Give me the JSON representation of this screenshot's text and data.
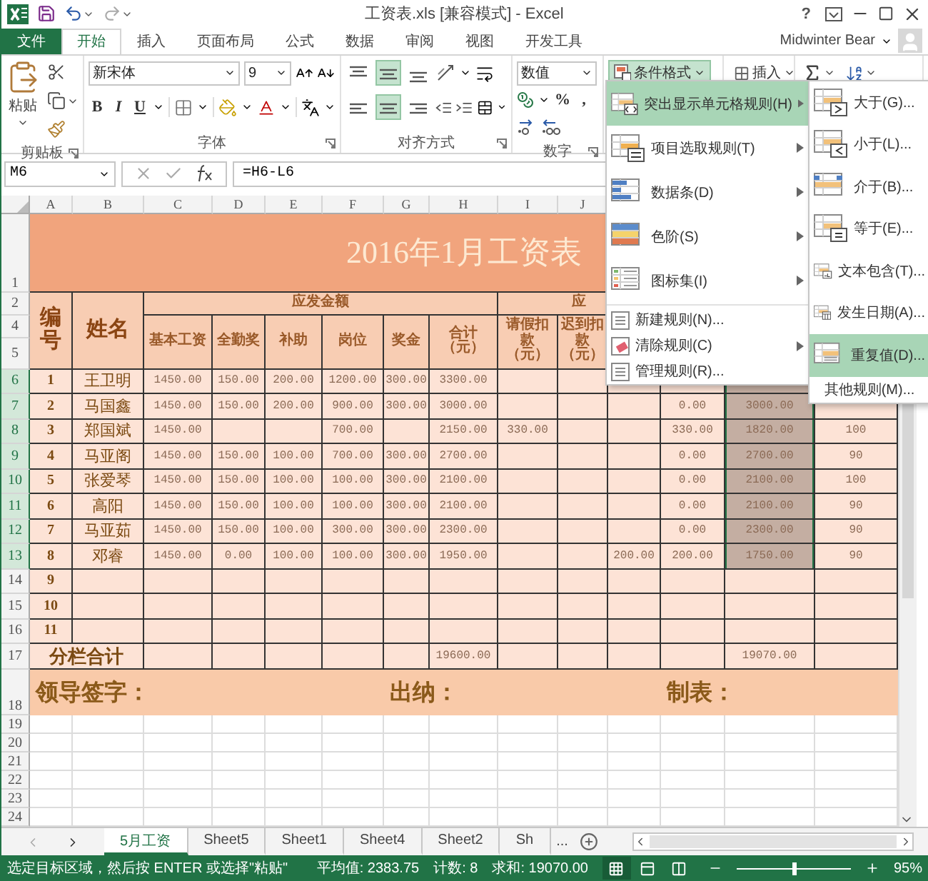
{
  "window": {
    "title": "工资表.xls  [兼容模式] - Excel",
    "help": "?"
  },
  "tabs": [
    {
      "label": "文件",
      "kind": "file",
      "selected": false
    },
    {
      "label": "开始",
      "kind": "tab",
      "selected": true
    },
    {
      "label": "插入",
      "kind": "tab",
      "selected": false
    },
    {
      "label": "页面布局",
      "kind": "tab",
      "selected": false
    },
    {
      "label": "公式",
      "kind": "tab",
      "selected": false
    },
    {
      "label": "数据",
      "kind": "tab",
      "selected": false
    },
    {
      "label": "审阅",
      "kind": "tab",
      "selected": false
    },
    {
      "label": "视图",
      "kind": "tab",
      "selected": false
    },
    {
      "label": "开发工具",
      "kind": "tab",
      "selected": false
    }
  ],
  "account": {
    "name": "Midwinter Bear"
  },
  "ribbon": {
    "clipboard": {
      "paste": "粘贴",
      "label": "剪贴板"
    },
    "font": {
      "family": "新宋体",
      "size": "9",
      "bold": "B",
      "italic": "I",
      "underline": "U",
      "label": "字体"
    },
    "alignment": {
      "vertical": [
        {
          "selected": false
        },
        {
          "selected": true
        },
        {
          "selected": false
        }
      ],
      "horizontal": [
        {
          "selected": false
        },
        {
          "selected": true
        },
        {
          "selected": false
        }
      ],
      "label": "对齐方式"
    },
    "number": {
      "format": "数值",
      "percent": "%",
      "comma": ",",
      "label": "数字"
    },
    "styles": {
      "conditional_formatting": "条件格式",
      "selected": true
    },
    "cells": {
      "insert": "插入"
    }
  },
  "formula_bar": {
    "name_box": "M6",
    "formula": "=H6-L6"
  },
  "sheet": {
    "columns": [
      "A",
      "B",
      "C",
      "D",
      "E",
      "F",
      "G",
      "H",
      "I",
      "J"
    ],
    "title": "2016年1月工资表",
    "header": {
      "number": "编号",
      "name": "姓名",
      "groups": [
        "应发金额",
        "应"
      ],
      "items": [
        "基本工资",
        "全勤奖",
        "补助",
        "岗位",
        "奖金",
        "合计（元）",
        "请假扣款（元）",
        "迟到扣款（元）"
      ]
    },
    "rows": [
      {
        "header": "1",
        "kind": "title",
        "selected": false
      },
      {
        "header": "2",
        "kind": "header",
        "selected": false
      },
      {
        "header": "4",
        "kind": "header",
        "selected": false
      },
      {
        "header": "5",
        "kind": "header",
        "selected": false
      },
      {
        "header": "6",
        "kind": "data",
        "selected": true,
        "cells": {
          "A": "1",
          "B": "王卫明",
          "C": "1450.00",
          "D": "150.00",
          "E": "200.00",
          "F": "1200.00",
          "G": "300.00",
          "H": "3300.00"
        }
      },
      {
        "header": "7",
        "kind": "data",
        "selected": true,
        "cells": {
          "A": "2",
          "B": "马国鑫",
          "C": "1450.00",
          "D": "150.00",
          "E": "200.00",
          "F": "900.00",
          "G": "300.00",
          "H": "3000.00",
          "L": "0.00",
          "M": "3000.00"
        }
      },
      {
        "header": "8",
        "kind": "data",
        "selected": true,
        "cells": {
          "A": "3",
          "B": "郑国斌",
          "C": "1450.00",
          "F": "700.00",
          "H": "2150.00",
          "I": "330.00",
          "L": "330.00",
          "M": "1820.00",
          "N": "100"
        }
      },
      {
        "header": "9",
        "kind": "data",
        "selected": true,
        "cells": {
          "A": "4",
          "B": "马亚阁",
          "C": "1450.00",
          "D": "150.00",
          "E": "100.00",
          "F": "700.00",
          "G": "300.00",
          "H": "2700.00",
          "L": "0.00",
          "M": "2700.00",
          "N": "90"
        }
      },
      {
        "header": "10",
        "kind": "data",
        "selected": true,
        "cells": {
          "A": "5",
          "B": "张爱琴",
          "C": "1450.00",
          "D": "150.00",
          "E": "100.00",
          "F": "100.00",
          "G": "300.00",
          "H": "2100.00",
          "L": "0.00",
          "M": "2100.00",
          "N": "100"
        }
      },
      {
        "header": "11",
        "kind": "data",
        "selected": true,
        "cells": {
          "A": "6",
          "B": "高阳",
          "C": "1450.00",
          "D": "150.00",
          "E": "100.00",
          "F": "100.00",
          "G": "300.00",
          "H": "2100.00",
          "L": "0.00",
          "M": "2100.00",
          "N": "90"
        }
      },
      {
        "header": "12",
        "kind": "data",
        "selected": true,
        "cells": {
          "A": "7",
          "B": "马亚茹",
          "C": "1450.00",
          "D": "150.00",
          "E": "100.00",
          "F": "300.00",
          "G": "300.00",
          "H": "2300.00",
          "L": "0.00",
          "M": "2300.00",
          "N": "90"
        }
      },
      {
        "header": "13",
        "kind": "data",
        "selected": true,
        "cells": {
          "A": "8",
          "B": "邓睿",
          "C": "1450.00",
          "D": "0.00",
          "E": "100.00",
          "F": "100.00",
          "G": "300.00",
          "H": "1950.00",
          "K": "200.00",
          "L": "200.00",
          "M": "1750.00",
          "N": "90"
        }
      },
      {
        "header": "14",
        "kind": "data",
        "selected": false,
        "cells": {
          "A": "9"
        }
      },
      {
        "header": "15",
        "kind": "data",
        "selected": false,
        "cells": {
          "A": "10"
        }
      },
      {
        "header": "16",
        "kind": "data",
        "selected": false,
        "cells": {
          "A": "11"
        }
      },
      {
        "header": "17",
        "kind": "total",
        "selected": false,
        "cells": {
          "A": "分栏合计",
          "H": "19600.00",
          "M": "19070.00"
        }
      },
      {
        "header": "18",
        "kind": "signature",
        "selected": false,
        "cells": {
          "A": "领导签字：",
          "G": "出纳：",
          "L": "制表："
        }
      },
      {
        "header": "19",
        "kind": "blank",
        "selected": false
      },
      {
        "header": "20",
        "kind": "blank",
        "selected": false
      },
      {
        "header": "21",
        "kind": "blank",
        "selected": false
      },
      {
        "header": "22",
        "kind": "blank",
        "selected": false
      },
      {
        "header": "23",
        "kind": "blank",
        "selected": false
      },
      {
        "header": "24",
        "kind": "blank",
        "selected": false
      }
    ]
  },
  "conditional_menu": {
    "items": [
      {
        "label": "突出显示单元格规则(H)",
        "kind": "large",
        "selected": true,
        "has_submenu": true
      },
      {
        "label": "项目选取规则(T)",
        "kind": "large",
        "selected": false,
        "has_submenu": true
      },
      {
        "label": "数据条(D)",
        "kind": "large",
        "selected": false,
        "has_submenu": true
      },
      {
        "label": "色阶(S)",
        "kind": "large",
        "selected": false,
        "has_submenu": true
      },
      {
        "label": "图标集(I)",
        "kind": "large",
        "selected": false,
        "has_submenu": true
      },
      {
        "label": "新建规则(N)...",
        "kind": "small",
        "selected": false,
        "has_submenu": false
      },
      {
        "label": "清除规则(C)",
        "kind": "small",
        "selected": false,
        "has_submenu": true
      },
      {
        "label": "管理规则(R)...",
        "kind": "small",
        "selected": false,
        "has_submenu": false
      }
    ]
  },
  "submenu": {
    "items": [
      {
        "label": "大于(G)...",
        "kind": "rule",
        "selected": false
      },
      {
        "label": "小于(L)...",
        "kind": "rule",
        "selected": false
      },
      {
        "label": "介于(B)...",
        "kind": "rule",
        "selected": false
      },
      {
        "label": "等于(E)...",
        "kind": "rule",
        "selected": false
      },
      {
        "label": "文本包含(T)...",
        "kind": "rule",
        "selected": false
      },
      {
        "label": "发生日期(A)...",
        "kind": "rule",
        "selected": false
      },
      {
        "label": "重复值(D)...",
        "kind": "rule",
        "selected": true
      },
      {
        "label": "其他规则(M)...",
        "kind": "more",
        "selected": false
      }
    ]
  },
  "sheet_tabs": {
    "tabs": [
      {
        "label": "5月工资",
        "selected": true
      },
      {
        "label": "Sheet5",
        "selected": false
      },
      {
        "label": "Sheet1",
        "selected": false
      },
      {
        "label": "Sheet4",
        "selected": false
      },
      {
        "label": "Sheet2",
        "selected": false
      },
      {
        "label": "Sh",
        "selected": false
      }
    ],
    "more": "..."
  },
  "status_bar": {
    "message": "选定目标区域，然后按 ENTER 或选择\"粘贴\"",
    "average": "平均值: 2383.75",
    "count": "计数: 8",
    "sum": "求和: 19070.00",
    "views": [
      {
        "selected": true
      },
      {
        "selected": false
      },
      {
        "selected": false
      }
    ],
    "zoom": {
      "level": 0.5,
      "reading": "95%"
    }
  }
}
